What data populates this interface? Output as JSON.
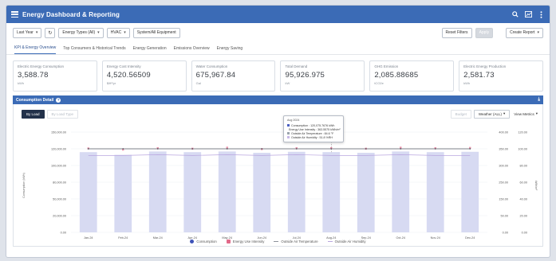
{
  "titlebar": {
    "title": "Energy Dashboard & Reporting",
    "icons": [
      "search-icon",
      "chart-icon",
      "more-vert-icon"
    ]
  },
  "toolbar": {
    "period": "Last Year",
    "energy_type": "Energy Types (All)",
    "hvac": "HVAC",
    "system_group": "System/All Equipment",
    "reset_filters": "Reset Filters",
    "apply": "Apply",
    "create_report": "Create Report"
  },
  "tabs": [
    "KPI & Energy Overview",
    "Top Consumers & Historical Trends",
    "Energy Generation",
    "Emissions Overview",
    "Energy Saving"
  ],
  "kpis": [
    {
      "label": "Electric Energy Consumption",
      "value": "3,588.78",
      "unit": "kWh"
    },
    {
      "label": "Energy Cost Intensity",
      "value": "4,520.56509",
      "unit": "$/ft²/yr"
    },
    {
      "label": "Water Consumption",
      "value": "675,967.84",
      "unit": "Gal"
    },
    {
      "label": "Total Demand",
      "value": "95,926.975",
      "unit": "kW"
    },
    {
      "label": "GHG Emission",
      "value": "2,085.88685",
      "unit": "tCO2e"
    },
    {
      "label": "Electric Energy Production",
      "value": "2,581.73",
      "unit": "kWh"
    }
  ],
  "section": {
    "title": "Consumption Detail",
    "download_icon": "download-icon"
  },
  "chart_controls": {
    "by_load": "By Load",
    "by_load_type": "By Load Type",
    "budget": "Budget",
    "weather": "Weather (ALL)",
    "view_metrics": "View Metrics"
  },
  "tooltip": {
    "title": "Aug 2024",
    "rows": [
      {
        "label": "Consumption : 120,075.7676 kWh",
        "color": "#4a5fc1"
      },
      {
        "label": "Energy Use Intensity : 363.5575 kWh/m²",
        "color": "#e06a8a"
      },
      {
        "label": "Outside Air Temperature : 84.6 °F",
        "color": "#9aa3ad"
      },
      {
        "label": "Outside Air Humidity : 51.8 %RH",
        "color": "#c7b8e6"
      }
    ]
  },
  "legend": [
    "Consumption",
    "Energy Use Intensity",
    "Outside Air Temperature",
    "Outside Air Humidity"
  ],
  "chart_data": {
    "type": "bar",
    "categories": [
      "Jan-24",
      "Feb-24",
      "Mar-24",
      "Apr-24",
      "May-24",
      "Jun-24",
      "Jul-24",
      "Aug-24",
      "Sep-24",
      "Oct-24",
      "Nov-24",
      "Dec-24"
    ],
    "series": [
      {
        "name": "Consumption",
        "values": [
          120000,
          116000,
          121000,
          120000,
          121000,
          119000,
          120500,
          120075.77,
          119000,
          121000,
          120000,
          120500
        ]
      },
      {
        "name": "Energy Use Intensity",
        "values": [
          335,
          330,
          336,
          334,
          338,
          332,
          336,
          336,
          334,
          338,
          336,
          337
        ]
      },
      {
        "name": "Outside Air Temperature",
        "values": [
          100,
          100,
          100,
          100,
          100,
          100,
          100,
          100,
          100,
          100,
          100,
          100
        ]
      },
      {
        "name": "Outside Air Humidity",
        "values": [
          92,
          92,
          93,
          92,
          93,
          92,
          93,
          92,
          92,
          93,
          92,
          92
        ]
      }
    ],
    "ylabel": "Consumption (kWh)",
    "y2label": "kWh/m²",
    "y3label": "Temp",
    "yticks": [
      "150,000.00",
      "120,000.00",
      "100,000.00",
      "80,000.00",
      "50,000.00",
      "20,000.00",
      "0.00"
    ],
    "y2ticks": [
      "400.00",
      "350.00",
      "300.00",
      "250.00",
      "150.00",
      "50.00",
      "0.00"
    ],
    "y3ticks": [
      "120.00",
      "100.00",
      "80.00",
      "60.00",
      "40.00",
      "20.00",
      "0.00"
    ],
    "ylim": [
      0,
      150000
    ],
    "y2lim": [
      0,
      400
    ],
    "y3lim": [
      0,
      120
    ],
    "colors": {
      "bar": "#d7daf2",
      "eui": "#e26a8a",
      "temp": "#555a63",
      "humidity": "#b9a6df"
    }
  }
}
